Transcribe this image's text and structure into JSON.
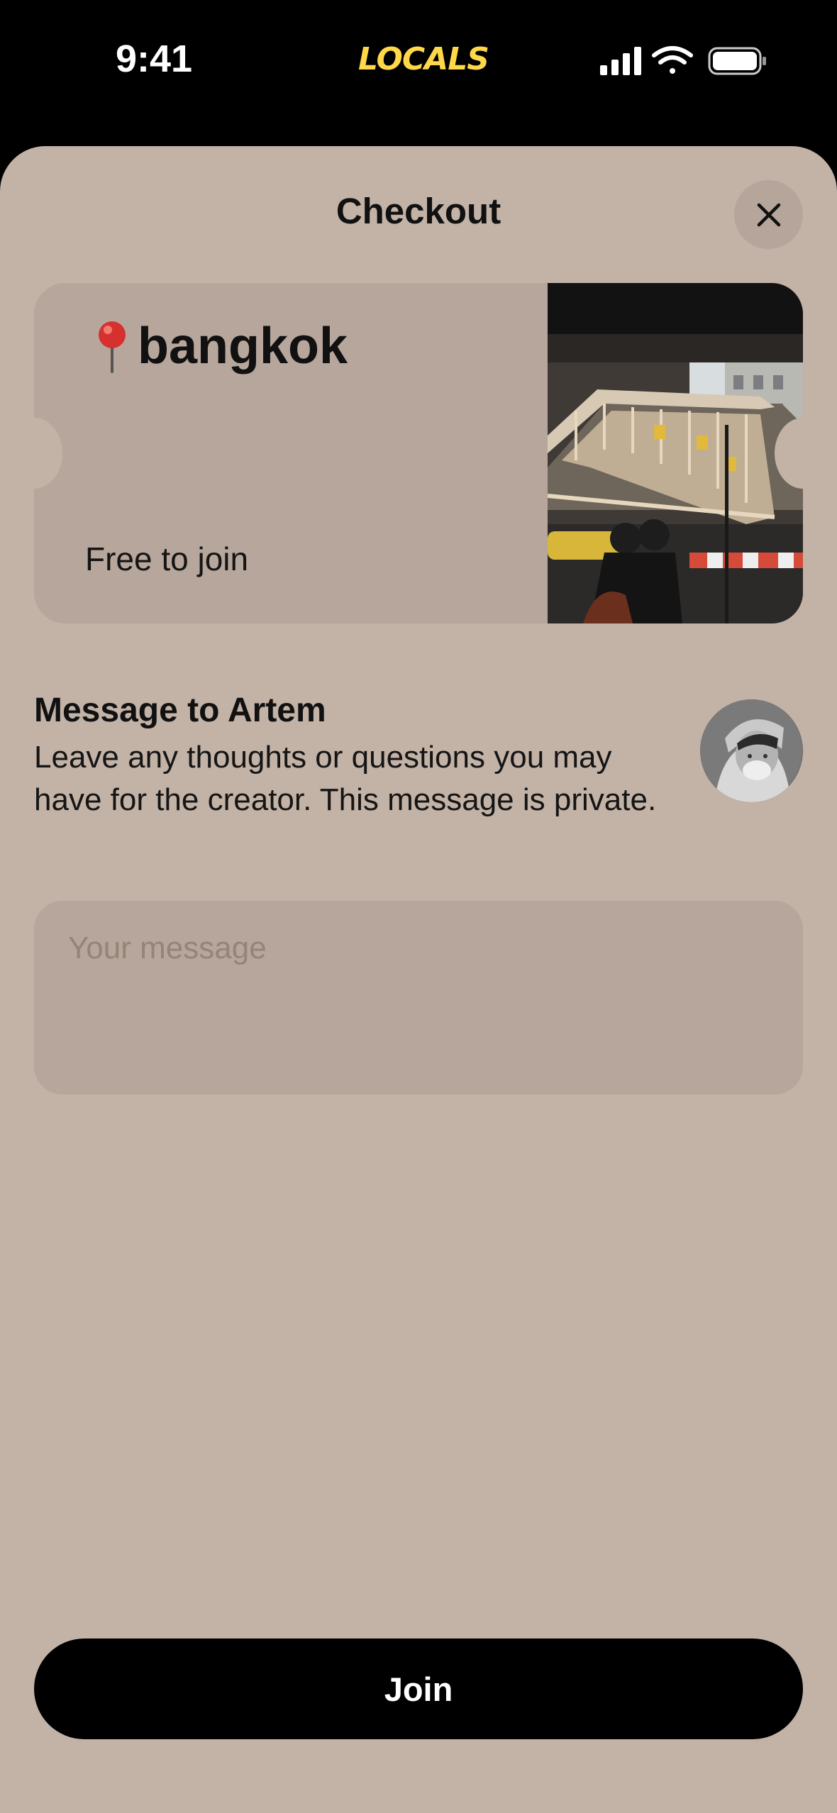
{
  "status_bar": {
    "time": "9:41",
    "logo": "LOCALS",
    "icons": [
      "cellular-signal-icon",
      "wifi-icon",
      "battery-icon"
    ]
  },
  "sheet": {
    "title": "Checkout",
    "close_icon": "close-icon"
  },
  "ticket": {
    "pin_icon": "round-pushpin-icon",
    "name": "bangkok",
    "price": "Free to join",
    "photo": "street-scene-photo"
  },
  "message": {
    "heading": "Message to Artem",
    "description": "Leave any thoughts or questions you may have for the creator. This message is private.",
    "placeholder": "Your message",
    "value": ""
  },
  "join": {
    "label": "Join"
  },
  "colors": {
    "sheet_background": "#c3b2a6",
    "card_background": "#b6a69b",
    "logo_yellow": "#ffd84a",
    "button_black": "#000000"
  }
}
